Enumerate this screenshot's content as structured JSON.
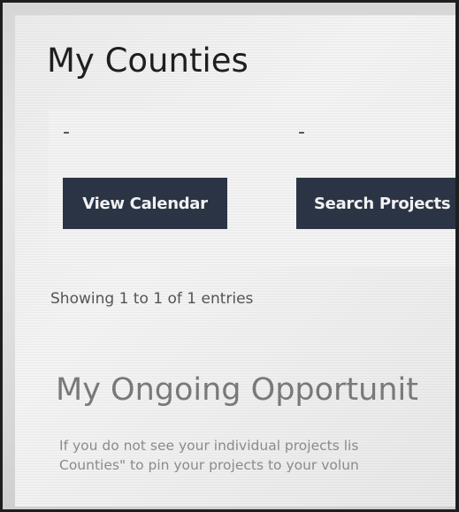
{
  "page": {
    "title": "My Counties"
  },
  "counties": [
    {
      "name": "-"
    },
    {
      "name": "-"
    }
  ],
  "buttons": {
    "view_calendar": "View Calendar",
    "search_projects": "Search Projects"
  },
  "table": {
    "entries_info": "Showing 1 to 1 of 1 entries"
  },
  "ongoing": {
    "title": "My Ongoing Opportunit",
    "description_line1": "If you do not see your individual projects lis",
    "description_line2": "Counties\" to pin your projects to your volun"
  },
  "colors": {
    "button_bg": "#2b3546",
    "button_text": "#f5f5f5",
    "card_bg": "#f3f3f3"
  }
}
